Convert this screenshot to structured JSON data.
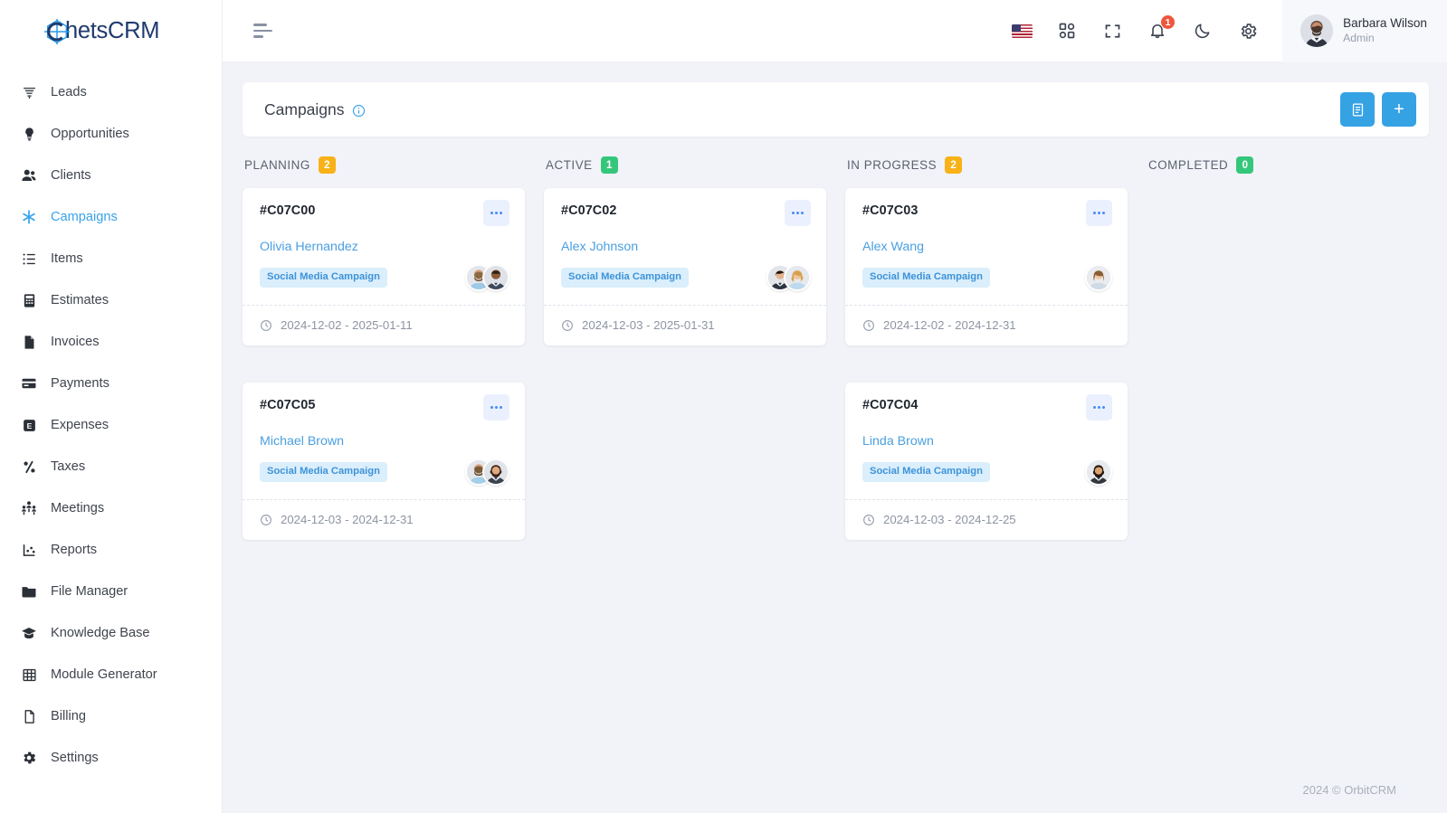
{
  "brand": {
    "logo_text": "hetsCRM",
    "logo_mark": "c-crosshair-icon",
    "accent": "#38a3e8",
    "logo_color": "#1e3a6e"
  },
  "sidebar": {
    "items": [
      {
        "label": "Leads",
        "icon": "funnel-icon",
        "active": false
      },
      {
        "label": "Opportunities",
        "icon": "lightbulb-icon",
        "active": false
      },
      {
        "label": "Clients",
        "icon": "users-icon",
        "active": false
      },
      {
        "label": "Campaigns",
        "icon": "asterisk-icon",
        "active": true
      },
      {
        "label": "Items",
        "icon": "list-icon",
        "active": false
      },
      {
        "label": "Estimates",
        "icon": "calculator-icon",
        "active": false
      },
      {
        "label": "Invoices",
        "icon": "file-icon",
        "active": false
      },
      {
        "label": "Payments",
        "icon": "credit-card-icon",
        "active": false
      },
      {
        "label": "Expenses",
        "icon": "expense-icon",
        "active": false
      },
      {
        "label": "Taxes",
        "icon": "percent-icon",
        "active": false
      },
      {
        "label": "Meetings",
        "icon": "people-group-icon",
        "active": false
      },
      {
        "label": "Reports",
        "icon": "chart-icon",
        "active": false
      },
      {
        "label": "File Manager",
        "icon": "folder-icon",
        "active": false
      },
      {
        "label": "Knowledge Base",
        "icon": "graduation-cap-icon",
        "active": false
      },
      {
        "label": "Module Generator",
        "icon": "grid-table-icon",
        "active": false
      },
      {
        "label": "Billing",
        "icon": "document-icon",
        "active": false
      },
      {
        "label": "Settings",
        "icon": "gear-icon",
        "active": false
      }
    ]
  },
  "topbar": {
    "menu_toggle": "menu-toggle-icon",
    "icons": [
      {
        "name": "language-flag-us",
        "label": "US"
      },
      {
        "name": "apps-grid-icon",
        "label": ""
      },
      {
        "name": "fullscreen-icon",
        "label": ""
      },
      {
        "name": "notifications-bell-icon",
        "label": ""
      },
      {
        "name": "dark-mode-moon-icon",
        "label": ""
      },
      {
        "name": "settings-gear-icon",
        "label": ""
      }
    ],
    "notification_count": "1",
    "user": {
      "name": "Barbara Wilson",
      "role": "Admin"
    }
  },
  "page": {
    "title": "Campaigns",
    "info_icon": "info-circle-icon",
    "actions": [
      {
        "name": "list-view-button",
        "icon": "list-view-icon"
      },
      {
        "name": "add-campaign-button",
        "icon": "plus-icon",
        "glyph": "+"
      }
    ]
  },
  "board": {
    "columns": [
      {
        "title": "PLANNING",
        "count": "2",
        "badge_color": "amber",
        "cards": [
          {
            "id": "#C07C00",
            "person": "Olivia Hernandez",
            "tag": "Social Media Campaign",
            "dates": "2024-12-02 - 2025-01-11",
            "avatars": 2,
            "menu": "card-menu-icon"
          },
          {
            "id": "#C07C05",
            "person": "Michael Brown",
            "tag": "Social Media Campaign",
            "dates": "2024-12-03 - 2024-12-31",
            "avatars": 2,
            "menu": "card-menu-icon"
          }
        ]
      },
      {
        "title": "ACTIVE",
        "count": "1",
        "badge_color": "green",
        "cards": [
          {
            "id": "#C07C02",
            "person": "Alex Johnson",
            "tag": "Social Media Campaign",
            "dates": "2024-12-03 - 2025-01-31",
            "avatars": 2,
            "menu": "card-menu-icon"
          }
        ]
      },
      {
        "title": "IN PROGRESS",
        "count": "2",
        "badge_color": "amber",
        "cards": [
          {
            "id": "#C07C03",
            "person": "Alex Wang",
            "tag": "Social Media Campaign",
            "dates": "2024-12-02 - 2024-12-31",
            "avatars": 1,
            "menu": "card-menu-icon"
          },
          {
            "id": "#C07C04",
            "person": "Linda Brown",
            "tag": "Social Media Campaign",
            "dates": "2024-12-03 - 2024-12-25",
            "avatars": 1,
            "menu": "card-menu-icon"
          }
        ]
      },
      {
        "title": "COMPLETED",
        "count": "0",
        "badge_color": "green",
        "cards": []
      }
    ]
  },
  "footer": {
    "copyright": "2024 © OrbitCRM"
  }
}
